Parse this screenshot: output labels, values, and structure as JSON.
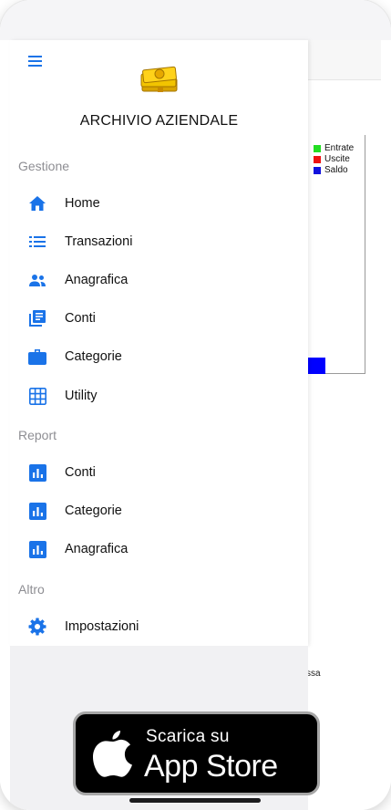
{
  "drawer": {
    "title": "ARCHIVIO AZIENDALE",
    "menu_icon": "hamburger-menu-icon",
    "logo_icon": "money-stack-icon",
    "sections": [
      {
        "header": "Gestione",
        "items": [
          {
            "label": "Home",
            "icon": "home-icon"
          },
          {
            "label": "Transazioni",
            "icon": "list-icon"
          },
          {
            "label": "Anagrafica",
            "icon": "people-icon"
          },
          {
            "label": "Conti",
            "icon": "library-books-icon"
          },
          {
            "label": "Categorie",
            "icon": "briefcase-icon"
          },
          {
            "label": "Utility",
            "icon": "grid-icon"
          }
        ]
      },
      {
        "header": "Report",
        "items": [
          {
            "label": "Conti",
            "icon": "bar-chart-icon"
          },
          {
            "label": "Categorie",
            "icon": "bar-chart-icon"
          },
          {
            "label": "Anagrafica",
            "icon": "bar-chart-icon"
          }
        ]
      },
      {
        "header": "Altro",
        "items": [
          {
            "label": "Impostazioni",
            "icon": "settings-gear-icon"
          }
        ]
      }
    ]
  },
  "background": {
    "legend": [
      {
        "label": "Entrate",
        "color": "#22dd22"
      },
      {
        "label": "Uscite",
        "color": "#ee1111"
      },
      {
        "label": "Saldo",
        "color": "#1111dd"
      }
    ],
    "text_fragment": "ssa"
  },
  "badge": {
    "small_text": "Scarica su",
    "big_text": "App Store",
    "icon": "apple-logo-icon"
  },
  "colors": {
    "accent": "#1a73e8",
    "section_header": "#8e8e93"
  }
}
